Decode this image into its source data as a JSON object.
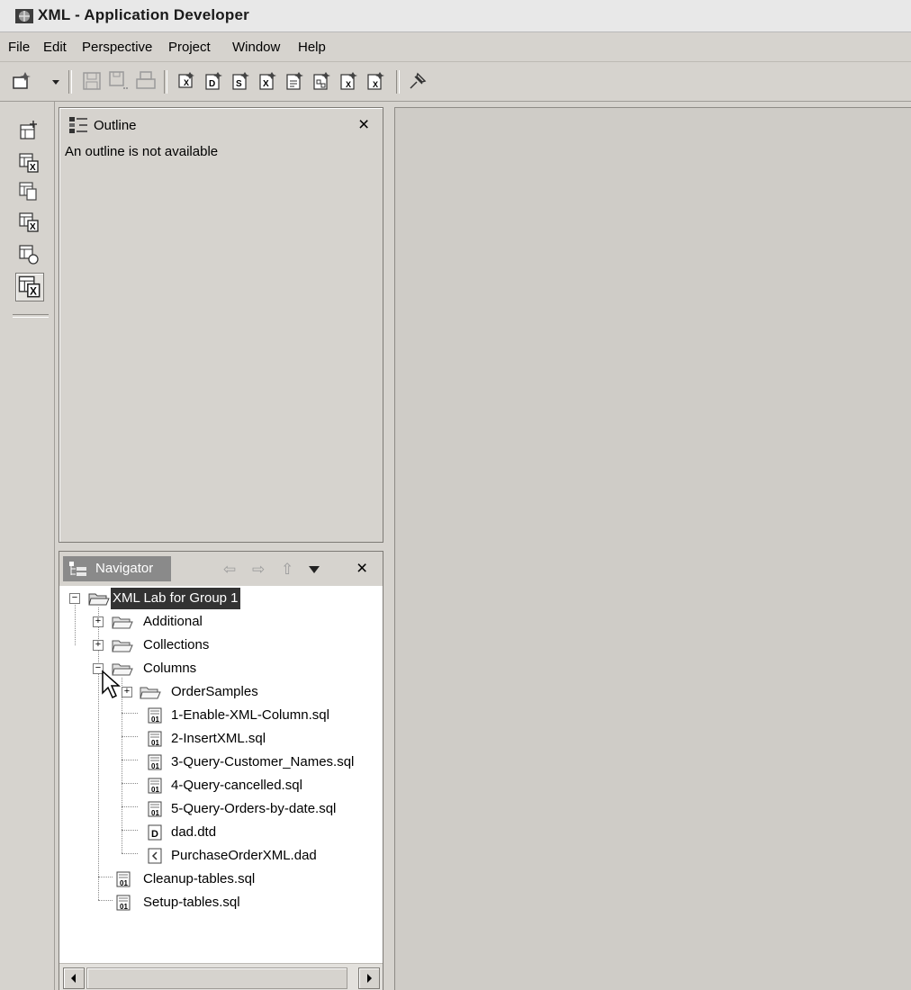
{
  "window": {
    "title": "XML - Application Developer"
  },
  "menu": [
    "File",
    "Edit",
    "Perspective",
    "Project",
    "Window",
    "Help"
  ],
  "toolbar": {
    "buttons": [
      "new-wizard-icon",
      "dropdown-arrow-icon",
      "save-icon",
      "save-all-icon",
      "print-icon",
      "xml-table-icon",
      "dtd-file-icon",
      "xsd-file-icon",
      "xml-file-icon",
      "xsl-file-icon",
      "xml-mapping-icon",
      "xml-to-sql-icon",
      "sql-to-xml-icon",
      "pin-icon"
    ]
  },
  "shortcuts": [
    "open-perspective-icon",
    "xml-perspective-icon",
    "data-perspective-icon",
    "xml-table-perspective-icon",
    "db-explorer-icon",
    "active-xml-perspective-icon"
  ],
  "outline": {
    "title": "Outline",
    "message": "An outline is not available"
  },
  "navigator": {
    "title": "Navigator",
    "tree": [
      {
        "label": "XML Lab for Group 1",
        "icon": "open-project-folder-icon",
        "expander": "−",
        "selected": true
      },
      {
        "label": "Additional",
        "icon": "folder-icon",
        "expander": "+"
      },
      {
        "label": "Collections",
        "icon": "folder-icon",
        "expander": "+"
      },
      {
        "label": "Columns",
        "icon": "open-folder-icon",
        "expander": "−"
      },
      {
        "label": "OrderSamples",
        "icon": "folder-icon",
        "expander": "+"
      },
      {
        "label": "1-Enable-XML-Column.sql",
        "icon": "sql-file-icon"
      },
      {
        "label": "2-InsertXML.sql",
        "icon": "sql-file-icon"
      },
      {
        "label": "3-Query-Customer_Names.sql",
        "icon": "sql-file-icon"
      },
      {
        "label": "4-Query-cancelled.sql",
        "icon": "sql-file-icon"
      },
      {
        "label": "5-Query-Orders-by-date.sql",
        "icon": "sql-file-icon"
      },
      {
        "label": "dad.dtd",
        "icon": "dtd-file-icon"
      },
      {
        "label": "PurchaseOrderXML.dad",
        "icon": "dad-file-icon"
      },
      {
        "label": "Cleanup-tables.sql",
        "icon": "sql-file-icon"
      },
      {
        "label": "Setup-tables.sql",
        "icon": "sql-file-icon"
      }
    ]
  }
}
